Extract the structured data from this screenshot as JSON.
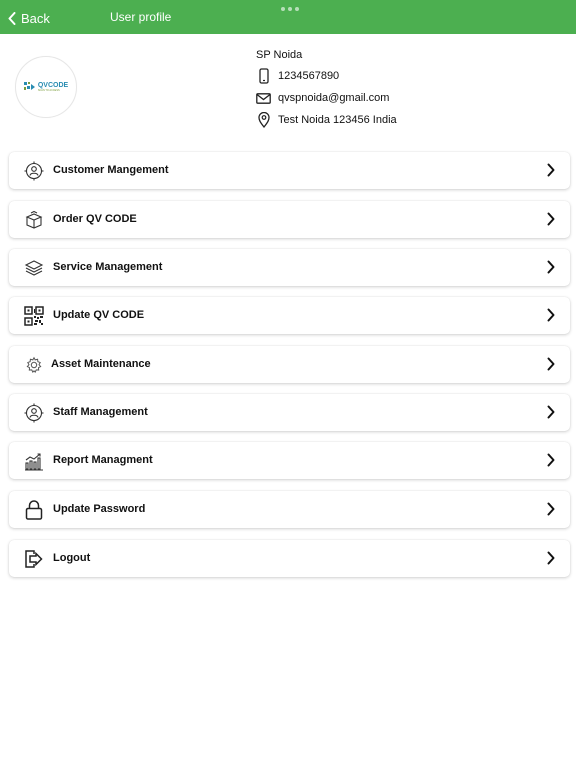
{
  "nav": {
    "back_label": "Back",
    "title": "User profile"
  },
  "logo": {
    "text": "QVCODE",
    "tagline": "SCAN TO ACCESS"
  },
  "profile": {
    "name": "SP Noida",
    "phone": "1234567890",
    "email": "qvspnoida@gmail.com",
    "address": "Test Noida 123456 India"
  },
  "menu": [
    {
      "label": "Customer Mangement",
      "icon": "customer-icon"
    },
    {
      "label": "Order QV CODE",
      "icon": "box-icon"
    },
    {
      "label": "Service Management",
      "icon": "service-icon"
    },
    {
      "label": "Update QV CODE",
      "icon": "qr-code-icon"
    },
    {
      "label": "Asset Maintenance",
      "icon": "gear-icon"
    },
    {
      "label": "Staff Management",
      "icon": "staff-icon"
    },
    {
      "label": "Report Managment",
      "icon": "report-icon"
    },
    {
      "label": "Update Password",
      "icon": "lock-icon"
    },
    {
      "label": "Logout",
      "icon": "logout-icon"
    }
  ],
  "colors": {
    "nav_bg": "#4caf50",
    "text": "#111111"
  }
}
